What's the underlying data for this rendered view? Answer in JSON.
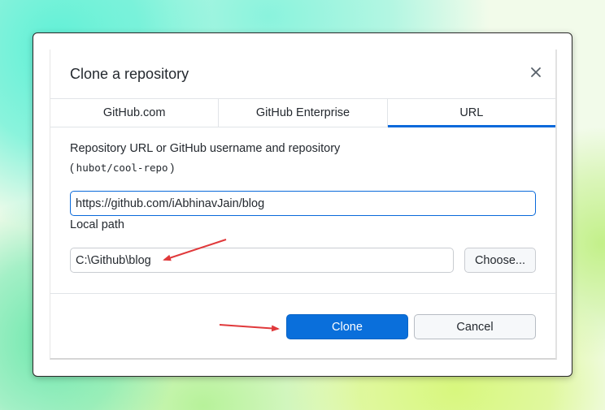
{
  "dialog": {
    "title": "Clone a repository",
    "close_icon": "close-icon"
  },
  "tabs": [
    {
      "label": "GitHub.com",
      "selected": false
    },
    {
      "label": "GitHub Enterprise",
      "selected": false
    },
    {
      "label": "URL",
      "selected": true
    }
  ],
  "url_field": {
    "label": "Repository URL or GitHub username and repository",
    "hint_prefix": "(",
    "hint_code": "hubot/cool-repo",
    "hint_suffix": ")",
    "value": "https://github.com/iAbhinavJain/blog"
  },
  "local_path": {
    "label": "Local path",
    "value": "C:\\Github\\blog",
    "choose_label": "Choose..."
  },
  "footer": {
    "clone_label": "Clone",
    "cancel_label": "Cancel"
  },
  "colors": {
    "accent": "#0969da",
    "primary_button": "#0a6fdb",
    "annotation_arrow": "#e0393b"
  }
}
